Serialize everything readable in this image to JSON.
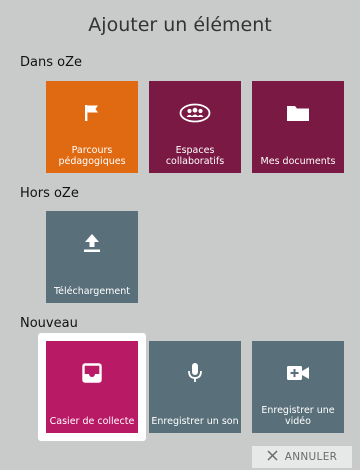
{
  "dialog": {
    "title": "Ajouter un élément",
    "sections": {
      "inside": "Dans oZe",
      "outside": "Hors oZe",
      "new": "Nouveau"
    },
    "tiles": {
      "parcours": {
        "label": "Parcours pédagogiques",
        "icon": "flag-icon",
        "color": "#e06a12"
      },
      "espaces": {
        "label": "Espaces collaboratifs",
        "icon": "group-icon",
        "color": "#7a1944"
      },
      "documents": {
        "label": "Mes documents",
        "icon": "folder-icon",
        "color": "#7a1944"
      },
      "telechargement": {
        "label": "Téléchargement",
        "icon": "upload-icon",
        "color": "#59707a"
      },
      "casier": {
        "label": "Casier de collecte",
        "icon": "inbox-tray-icon",
        "color": "#b81a66"
      },
      "son": {
        "label": "Enregistrer un son",
        "icon": "microphone-icon",
        "color": "#59707a"
      },
      "video": {
        "label": "Enregistrer une vidéo",
        "icon": "video-camera-add-icon",
        "color": "#59707a"
      }
    },
    "cancel_label": "ANNULER"
  }
}
